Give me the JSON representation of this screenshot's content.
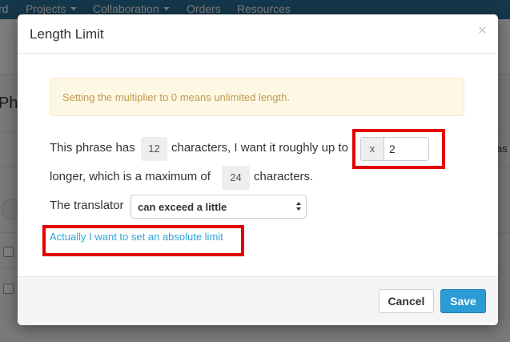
{
  "background": {
    "nav_items": [
      "rd",
      "Projects",
      "Collaboration",
      "Orders",
      "Resources"
    ],
    "page_fragment": "Ph",
    "right_fragment": "as"
  },
  "modal": {
    "title": "Length Limit",
    "close_glyph": "×",
    "alert_text": "Setting the multiplier to 0 means unlimited length.",
    "line1_prefix": "This phrase has",
    "phrase_char_count": "12",
    "line1_middle": "characters, I want it roughly up to",
    "multiplier_prefix": "x",
    "multiplier_value": "2",
    "line2_prefix": "longer, which is a maximum of",
    "max_char_count": "24",
    "line2_suffix": "characters.",
    "translator_label": "The translator",
    "translator_option": "can exceed a little",
    "absolute_limit_link": "Actually I want to set an absolute limit"
  },
  "footer": {
    "cancel_label": "Cancel",
    "save_label": "Save"
  },
  "colors": {
    "highlight_box": "#e50000",
    "save_button": "#2b9bd6",
    "link": "#2fa4d4",
    "alert_text": "#c09853",
    "alert_bg": "#fcf8e3"
  }
}
